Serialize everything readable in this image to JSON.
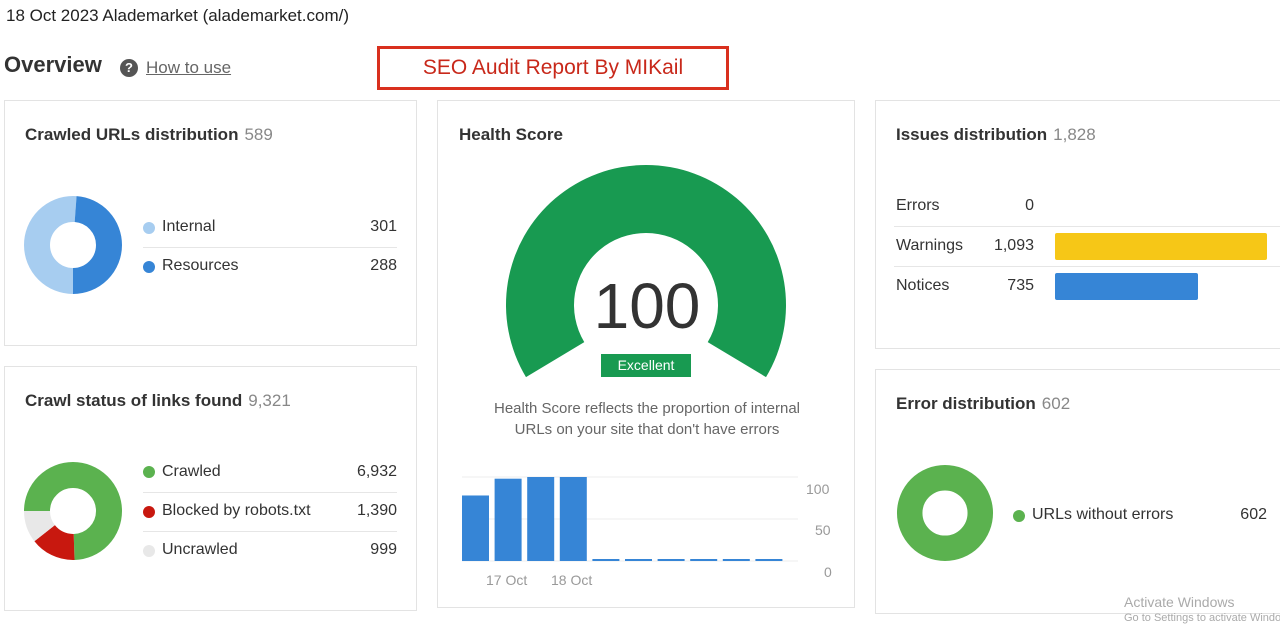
{
  "header": {
    "date_site": "18 Oct 2023 Alademarket (alademarket.com/)",
    "overview_title": "Overview",
    "help_icon": "question-circle-icon",
    "how_to_use": "How to use",
    "banner": "SEO Audit Report By MIKail"
  },
  "crawled_urls": {
    "title": "Crawled URLs distribution",
    "total": "589",
    "items": [
      {
        "label": "Internal",
        "value": "301",
        "color": "#a7cdf0"
      },
      {
        "label": "Resources",
        "value": "288",
        "color": "#3685d6"
      }
    ]
  },
  "crawl_status": {
    "title": "Crawl status of links found",
    "total": "9,321",
    "items": [
      {
        "label": "Crawled",
        "value": "6,932",
        "color": "#5bb24f"
      },
      {
        "label": "Blocked by robots.txt",
        "value": "1,390",
        "color": "#c8180f"
      },
      {
        "label": "Uncrawled",
        "value": "999",
        "color": "#e8e8e8"
      }
    ]
  },
  "health_score": {
    "title": "Health Score",
    "score": "100",
    "badge": "Excellent",
    "description_line1": "Health Score reflects the proportion of internal",
    "description_line2": "URLs on your site that don't have errors",
    "chart_data": {
      "type": "bar",
      "categories": [
        "",
        "17 Oct",
        "",
        "18 Oct",
        "",
        "",
        "",
        "",
        "",
        ""
      ],
      "values": [
        78,
        98,
        100,
        100,
        0,
        0,
        0,
        0,
        0,
        0
      ],
      "ylim": [
        0,
        100
      ],
      "yticks": [
        "100",
        "50",
        "0"
      ],
      "xticks": [
        "17 Oct",
        "18 Oct"
      ],
      "color": "#3685d6"
    }
  },
  "issues": {
    "title": "Issues distribution",
    "total": "1,828",
    "items": [
      {
        "label": "Errors",
        "value": "0",
        "count": 0,
        "color": "#d9301e"
      },
      {
        "label": "Warnings",
        "value": "1,093",
        "count": 1093,
        "color": "#f6c717"
      },
      {
        "label": "Notices",
        "value": "735",
        "count": 735,
        "color": "#3685d6"
      }
    ]
  },
  "error_distribution": {
    "title": "Error distribution",
    "total": "602",
    "items": [
      {
        "label": "URLs without errors",
        "value": "602",
        "color": "#5bb24f"
      }
    ]
  },
  "watermark": {
    "line1": "Activate Windows",
    "line2": "Go to Settings to activate Windows."
  }
}
